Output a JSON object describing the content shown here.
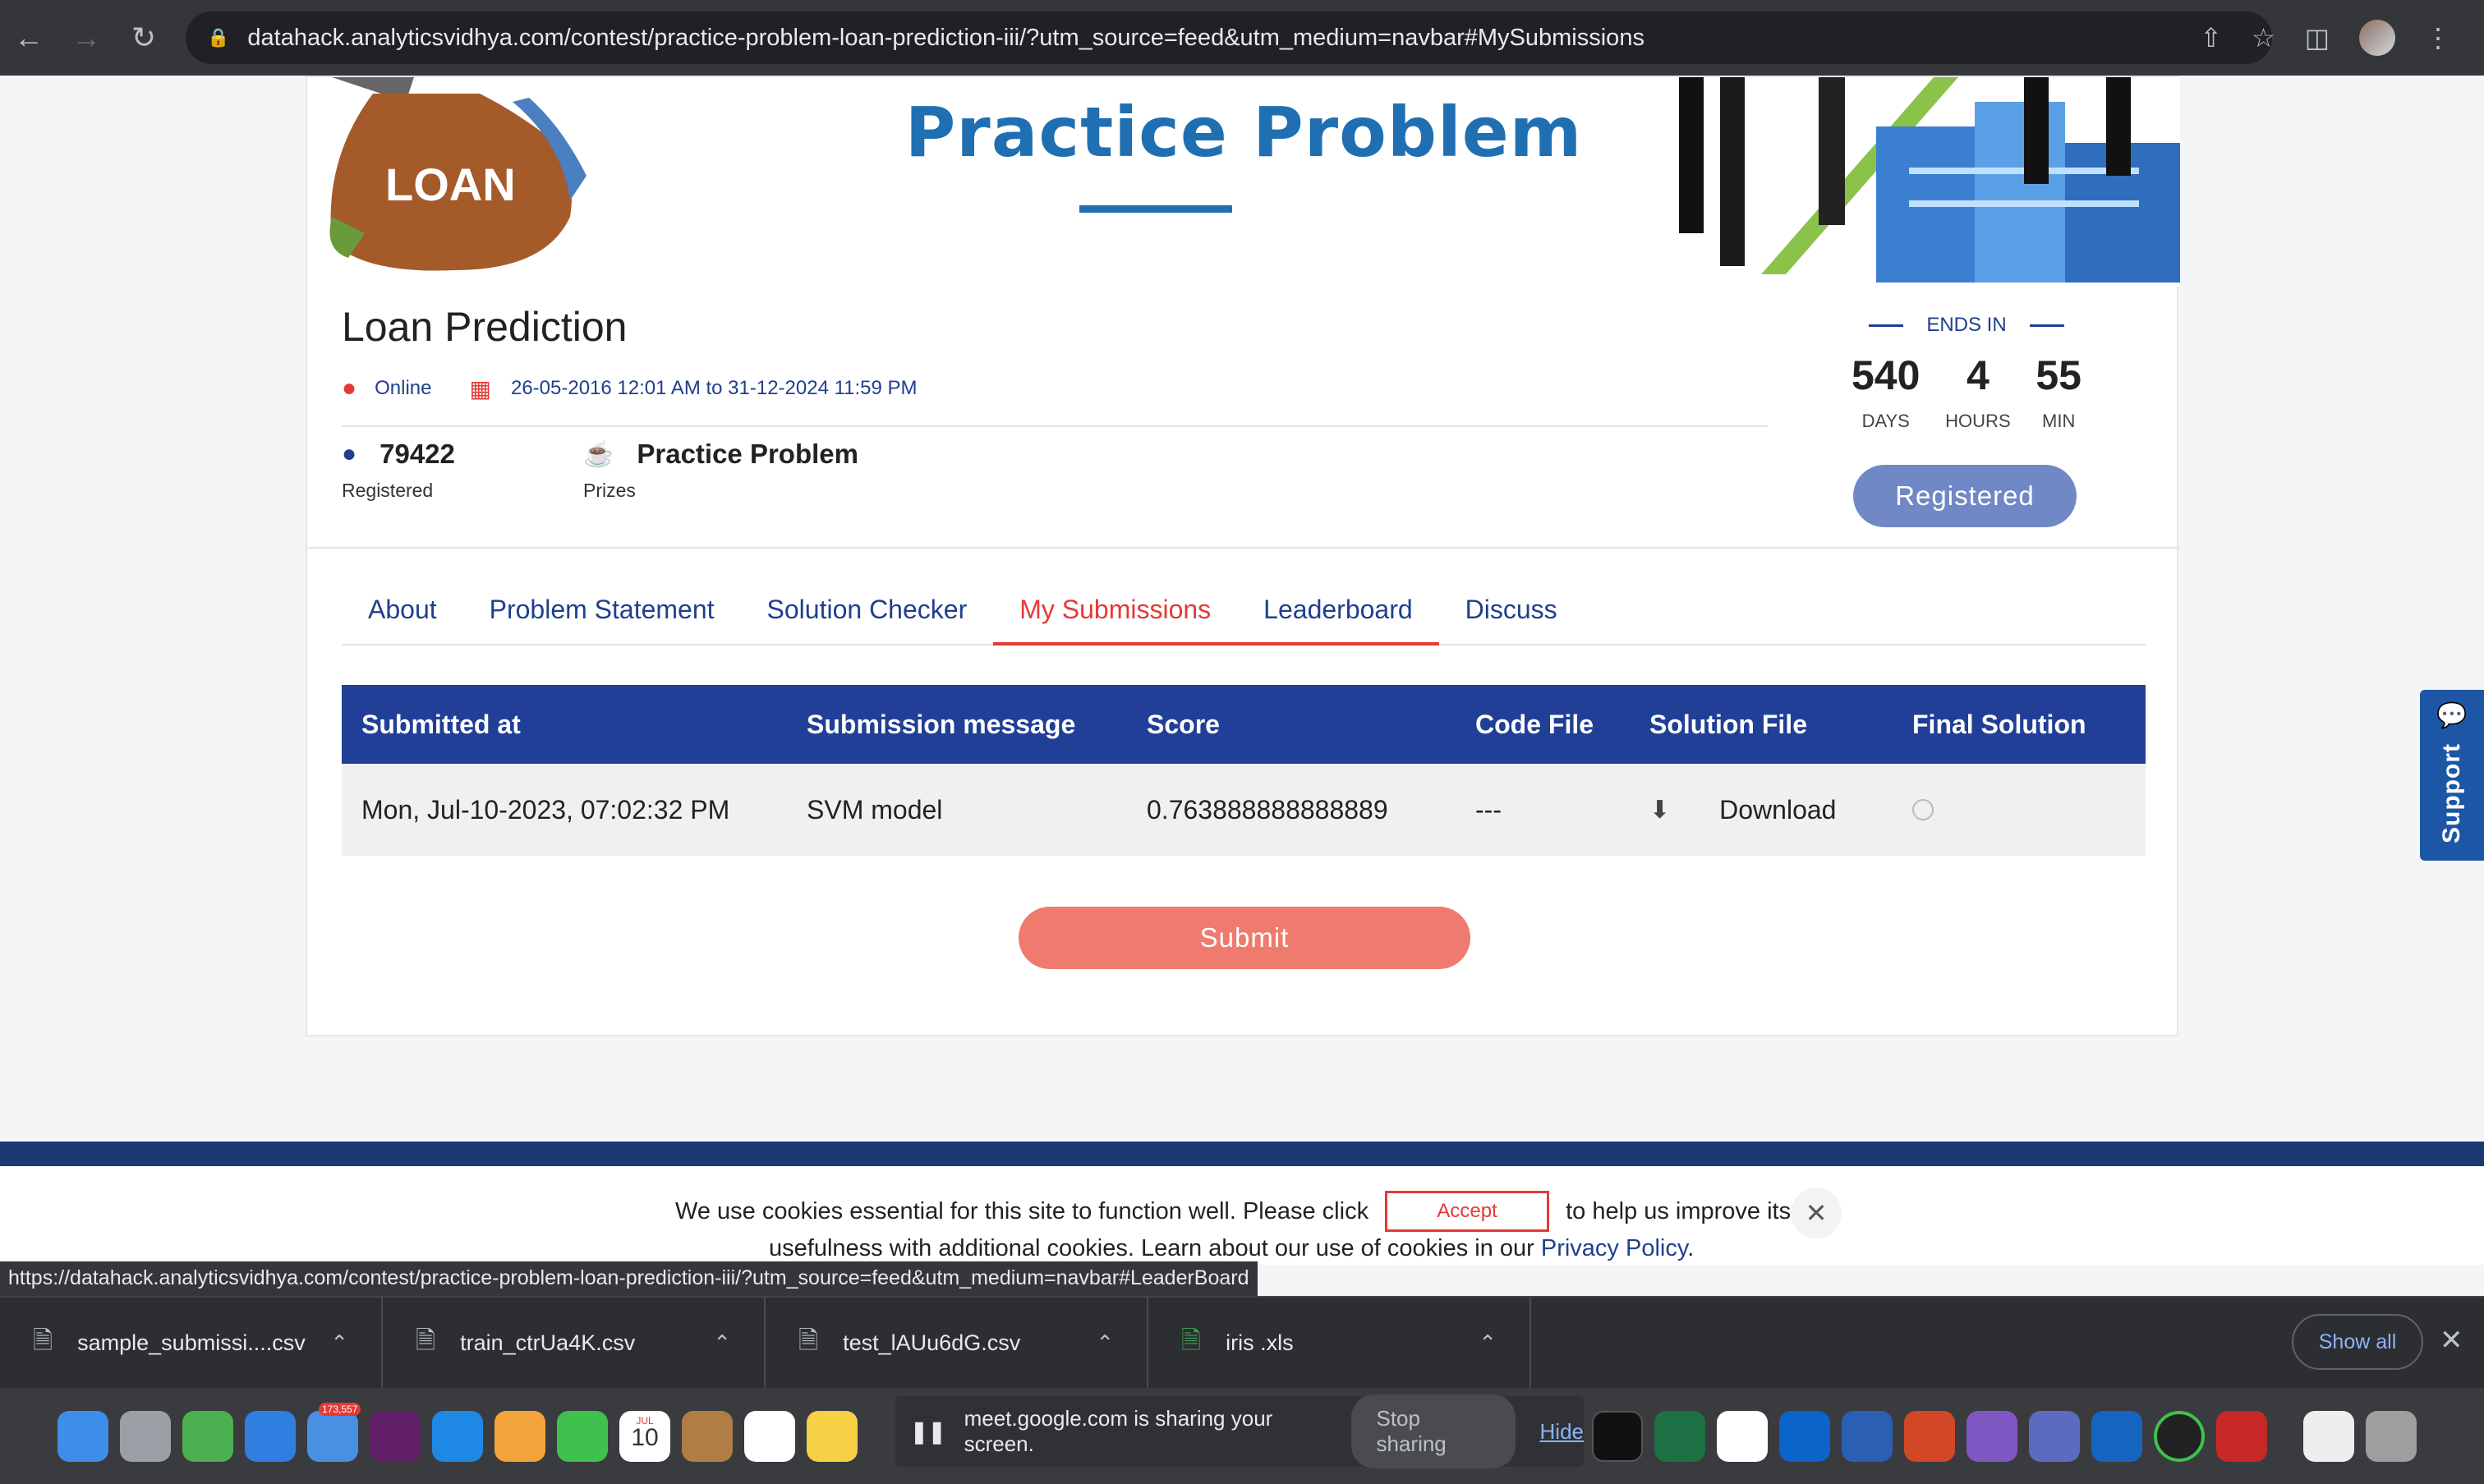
{
  "browser": {
    "url": "datahack.analyticsvidhya.com/contest/practice-problem-loan-prediction-iii/?utm_source=feed&utm_medium=navbar#MySubmissions"
  },
  "banner": {
    "bag_text": "LOAN",
    "title": "Practice Problem"
  },
  "contest": {
    "name": "Loan Prediction",
    "location": "Online",
    "dates": "26-05-2016 12:01 AM to 31-12-2024 11:59 PM",
    "registered_count": "79422",
    "registered_label": "Registered",
    "prize_value": "Practice Problem",
    "prize_label": "Prizes"
  },
  "countdown": {
    "label": "ENDS IN",
    "days": "540",
    "days_label": "DAYS",
    "hours": "4",
    "hours_label": "HOURS",
    "min": "55",
    "min_label": "MIN"
  },
  "registered_button": "Registered",
  "tabs": [
    {
      "label": "About"
    },
    {
      "label": "Problem Statement"
    },
    {
      "label": "Solution Checker"
    },
    {
      "label": "My Submissions"
    },
    {
      "label": "Leaderboard"
    },
    {
      "label": "Discuss"
    }
  ],
  "table": {
    "headers": [
      "Submitted at",
      "Submission message",
      "Score",
      "Code File",
      "Solution File",
      "Final Solution"
    ],
    "rows": [
      {
        "submitted_at": "Mon, Jul-10-2023, 07:02:32 PM",
        "message": "SVM model",
        "score": "0.763888888888889",
        "code_file": "---",
        "solution_file": "Download"
      }
    ]
  },
  "submit_button": "Submit",
  "cookie": {
    "text_before": "We use cookies essential for this site to function well. Please click",
    "accept": "Accept",
    "text_after": "to help us improve its",
    "line2": "usefulness with additional cookies. Learn about our use of cookies in our",
    "privacy": "Privacy Policy",
    "period": "."
  },
  "status_url": "https://datahack.analyticsvidhya.com/contest/practice-problem-loan-prediction-iii/?utm_source=feed&utm_medium=navbar#LeaderBoard",
  "support": "Support",
  "downloads": {
    "items": [
      "sample_submissi....csv",
      "train_ctrUa4K.csv",
      "test_lAUu6dG.csv",
      "iris .xls"
    ],
    "show_all": "Show all"
  },
  "screen_share": {
    "message": "meet.google.com is sharing your screen.",
    "stop": "Stop sharing",
    "hide": "Hide"
  },
  "dock": {
    "mail_badge": "173,557",
    "calendar_month": "JUL",
    "calendar_day": "10"
  },
  "colors": {
    "primary": "#213f96",
    "accent_red": "#e53935",
    "submit": "#ef7b6e",
    "registered": "#7088c5",
    "support": "#1c56a5"
  }
}
